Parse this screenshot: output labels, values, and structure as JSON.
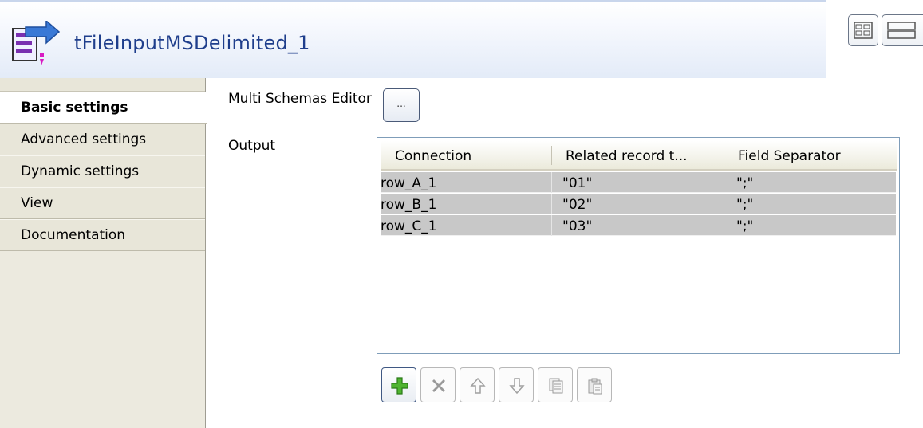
{
  "header": {
    "component_name": "tFileInputMSDelimited_1",
    "component_icon": "file-input-delimited-icon",
    "view_buttons": [
      "grid-view-icon",
      "list-view-icon"
    ]
  },
  "sidebar": {
    "items": [
      {
        "label": "Basic settings",
        "active": true
      },
      {
        "label": "Advanced settings",
        "active": false
      },
      {
        "label": "Dynamic settings",
        "active": false
      },
      {
        "label": "View",
        "active": false
      },
      {
        "label": "Documentation",
        "active": false
      }
    ]
  },
  "main": {
    "multi_schemas_label": "Multi Schemas Editor",
    "multi_schemas_button": "...",
    "output_label": "Output",
    "table": {
      "columns": [
        "Connection",
        "Related record t...",
        "Field Separator"
      ],
      "rows": [
        [
          "row_A_1",
          "\"01\"",
          "\";\""
        ],
        [
          "row_B_1",
          "\"02\"",
          "\";\""
        ],
        [
          "row_C_1",
          "\"03\"",
          "\";\""
        ]
      ]
    },
    "toolbar": [
      {
        "icon": "add-icon",
        "enabled": true
      },
      {
        "icon": "delete-icon",
        "enabled": false
      },
      {
        "icon": "move-up-icon",
        "enabled": false
      },
      {
        "icon": "move-down-icon",
        "enabled": false
      },
      {
        "icon": "copy-icon",
        "enabled": false
      },
      {
        "icon": "paste-icon",
        "enabled": false
      }
    ]
  },
  "colors": {
    "title": "#1f3e8c",
    "row_background": "#c8c8c8",
    "sidebar_background": "#e8e6d9"
  }
}
